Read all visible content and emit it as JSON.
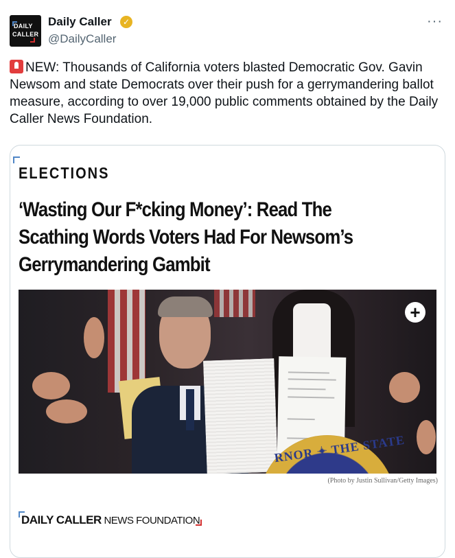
{
  "author": {
    "name": "Daily Caller",
    "handle": "@DailyCaller",
    "avatar_line1": "DAILY",
    "avatar_line2": "CALLER",
    "verified_badge": "gold-check-icon"
  },
  "menu": {
    "more_label": "···"
  },
  "tweet": {
    "emoji": "rotating-light-icon",
    "text": "NEW: Thousands of California voters blasted Democratic Gov. Gavin Newsom and state Democrats over their push for a gerrymandering ballot measure, according to over 19,000 public comments obtained by the Daily Caller News Foundation."
  },
  "card": {
    "section": "ELECTIONS",
    "headline": "‘Wasting Our F*cking Money’: Read The Scathing Words Voters Had For Newsom’s Gerrymandering Gambit",
    "photo_plus": "+",
    "seal_text": "RNOR ✦ THE STATE",
    "caption": "(Photo by Justin Sullivan/Getty Images)",
    "footer_bold": "DAILY CALLER",
    "footer_rest": " NEWS FOUNDATION"
  },
  "colors": {
    "accent_blue": "#4f86c6",
    "accent_red": "#d32f2f",
    "handle_gray": "#536471",
    "badge_gold": "#e8b423"
  }
}
